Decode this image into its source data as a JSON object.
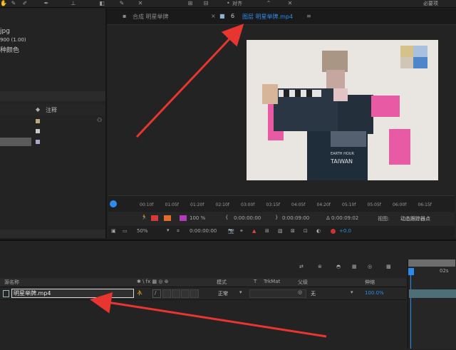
{
  "topbar": {
    "left_label": "对齐",
    "right_label": "必要项"
  },
  "project": {
    "file_name_partial": "jpg",
    "file_meta": "900 (1.00)",
    "file_color": "种颜色",
    "column_comment": "注释"
  },
  "composition": {
    "tab_comp": "合成 明星举牌",
    "tab_layer": "图层 明星举牌.mp4",
    "tab_num": "6",
    "tab_menu": "≡"
  },
  "ruler": {
    "ticks": [
      "00:10f",
      "01:05f",
      "01:20f",
      "02:10f",
      "03:00f",
      "03:15f",
      "04:05f",
      "04:20f",
      "05:10f",
      "05:05f",
      "06:00f",
      "06:15f"
    ]
  },
  "controls": {
    "zoom_percent": "100 %",
    "in_time": "0:00:00:00",
    "out_time": "0:00:09:00",
    "duration": "Δ 0:00:09:02",
    "view_label": "视图:",
    "view_value": "动态跟踪器点"
  },
  "viewbar": {
    "zoom": "50%",
    "timecode": "0:00:00:00",
    "offset": "+0.0"
  },
  "timeline": {
    "col_source": "源名称",
    "col_mode": "模式",
    "col_t": "T",
    "col_trkmat": "TrkMat",
    "col_parent": "父级",
    "col_stretch": "伸缩",
    "ruler_2s": "02s",
    "layer": {
      "name": "明星举牌.mp4",
      "mode": "正常",
      "parent": "无",
      "stretch": "100.0%"
    }
  },
  "frame_text": {
    "line1": "EARTH HOUR",
    "line2": "TAIWAN"
  },
  "colors": {
    "accent_blue": "#2d8ceb",
    "arrow_red": "#e8352f",
    "shirt_pink": "#ef5da6"
  }
}
